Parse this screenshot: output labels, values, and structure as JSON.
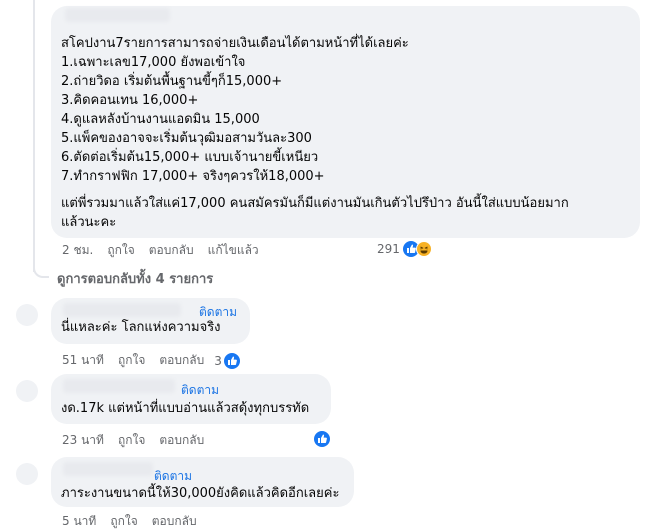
{
  "main_comment": {
    "lines": [
      "สโคปงาน7รายการสามารถจ่ายเงินเดือนได้ตามหน้าที่ได้เลยค่ะ",
      "1.เฉพาะเลข17,000 ยังพอเข้าใจ",
      "2.ถ่ายวิดอ เริ่มต้นพื้นฐานขี้ๆก็15,000+",
      "3.คิดคอนเทน 16,000+",
      "4.ดูแลหลังบ้านงานแอดมิน 15,000",
      "5.แพ็คของอาจจะเริ่มต้นวุฒิมอสามวันละ300",
      "6.ตัดต่อเริ่มต้น15,000+ แบบเจ้านายขี้เหนียว",
      "7.ทำกราฟฟิก 17,000+ จริงๆควรให้18,000+",
      "แต่พี่รวมมาแล้วใส่แค่17,000 คนสมัครมันก็มีแต่งานมันเกินตัวไปรึป่าว อันนี้ใส่แบบน้อยมาก",
      "แล้วนะคะ"
    ],
    "time": "2 ชม.",
    "like": "ถูกใจ",
    "reply": "ตอบกลับ",
    "edited": "แก้ไขแล้ว",
    "reaction_count": "291"
  },
  "view_replies": "ดูการตอบกลับทั้ง 4 รายการ",
  "replies": [
    {
      "follow": "ติดตาม",
      "text": "นี่แหละค่ะ โลกแห่งความจริง",
      "time": "51 นาที",
      "like": "ถูกใจ",
      "reply": "ตอบกลับ",
      "reaction_count": "3"
    },
    {
      "follow": "ติดตาม",
      "text": "งด.17k แต่หน้าที่แบบอ่านแล้วสดุ้งทุกบรรทัด",
      "time": "23 นาที",
      "like": "ถูกใจ",
      "reply": "ตอบกลับ",
      "reaction_count": ""
    },
    {
      "follow": "ติดตาม",
      "text": "ภาระงานขนาดนี้ให้30,000ยังคิดแล้วคิดอีกเลยค่ะ",
      "time": "5 นาที",
      "like": "ถูกใจ",
      "reply": "ตอบกลับ"
    }
  ],
  "colors": {
    "bubble": "#f0f2f5",
    "link": "#1b74e4",
    "meta": "#65676b",
    "like_blue": "#1877f2"
  },
  "icons": [
    "like-icon",
    "haha-icon"
  ]
}
